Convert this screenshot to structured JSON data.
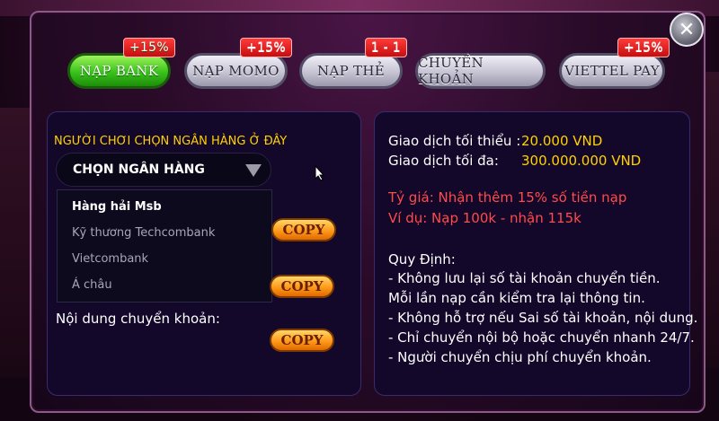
{
  "tabs": [
    {
      "label": "NẠP BANK",
      "badge": "+15%"
    },
    {
      "label": "NẠP MOMO",
      "badge": "+15%"
    },
    {
      "label": "NẠP THẺ",
      "badge": "1 - 1"
    },
    {
      "label": "CHUYỂN KHOẢN",
      "badge": ""
    },
    {
      "label": "VIETTEL PAY",
      "badge": "+15%"
    }
  ],
  "close_label": "✕",
  "left_panel": {
    "choose_label": "NGƯỜI CHƠI CHỌN NGÂN HÀNG Ở ĐÂY",
    "select_value": "CHỌN NGÂN HÀNG",
    "dropdown_options": [
      "Hàng hải Msb",
      "Kỹ thương Techcombank",
      "Vietcombank",
      "Á châu"
    ],
    "copy_label": "COPY",
    "content_label": "Nội dung chuyển khoản:"
  },
  "right_panel": {
    "min_label": "Giao dịch tối thiểu :",
    "min_value": "20.000 VND",
    "max_label": "Giao dịch tối đa:",
    "max_value": "300.000.000 VND",
    "rate_line": "Tỷ giá: Nhận thêm 15% số tiền nạp",
    "example_line": "Ví dụ: Nạp 100k - nhận 115k",
    "rules_title": "Quy Định:",
    "rules": [
      "- Không lưu lại số tài khoản chuyển tiền.",
      "Mỗi lần nạp cần kiểm tra lại thông tin.",
      "- Không hỗ trợ nếu Sai số tài khoản, nội dung.",
      "- Chỉ chuyển nội bộ hoặc chuyển nhanh 24/7.",
      "- Người chuyển chịu phí chuyển khoản."
    ]
  },
  "colors": {
    "accent_yellow": "#ffd200",
    "accent_red": "#ff4b4b",
    "tab_active": "#38c21a"
  }
}
